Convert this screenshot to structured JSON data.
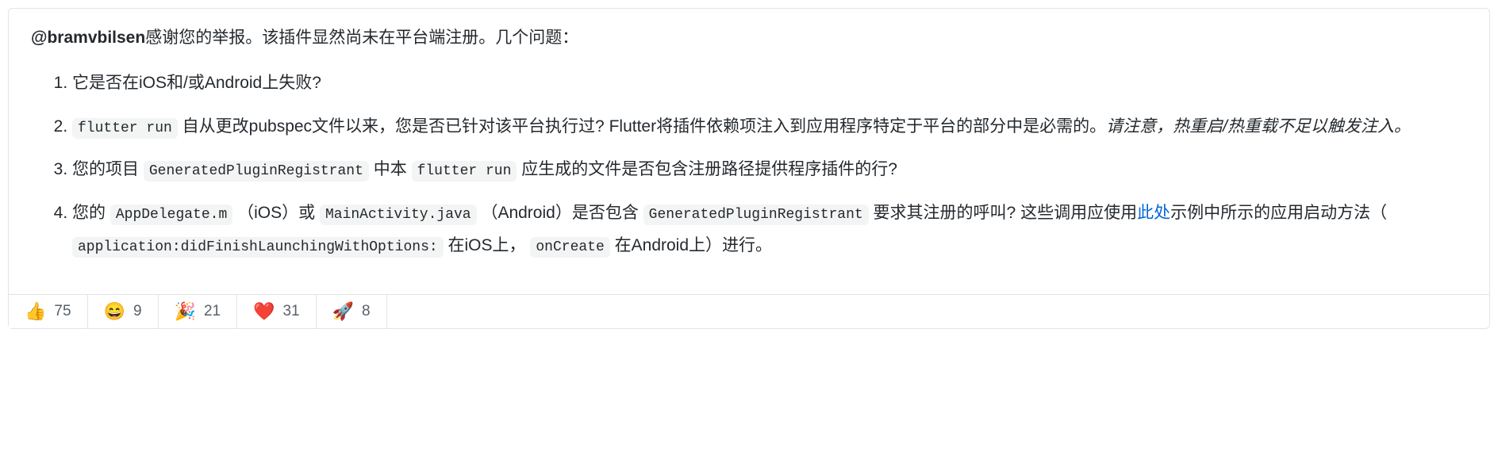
{
  "comment": {
    "mention": "@bramvbilsen",
    "intro_text": "感谢您的举报。该插件显然尚未在平台端注册。几个问题：",
    "questions": {
      "q1": "它是否在iOS和/或Android上失败?",
      "q2": {
        "code_flutter_run": "flutter run",
        "text_after_code": " 自从更改pubspec文件以来，您是否已针对该平台执行过? Flutter将插件依赖项注入到应用程序特定于平台的部分中是必需的。",
        "italic_note": "请注意，热重启/热重载不足以触发注入。"
      },
      "q3": {
        "text_before_code1": "您的项目 ",
        "code_gpr": "GeneratedPluginRegistrant",
        "text_middle": " 中本 ",
        "code_flutter_run": "flutter run",
        "text_after": " 应生成的文件是否包含注册路径提供程序插件的行?"
      },
      "q4": {
        "text_before_code1": "您的 ",
        "code_appdelegate": "AppDelegate.m",
        "text_ios": " （iOS）或 ",
        "code_mainactivity": "MainActivity.java",
        "text_android": " （Android）是否包含 ",
        "code_gpr": "GeneratedPluginRegistrant",
        "text_after_gpr": " 要求其注册的呼叫? 这些调用应使用",
        "link_text": "此处",
        "text_after_link": "示例中所示的应用启动方法（ ",
        "code_didfinish": "application:didFinishLaunchingWithOptions:",
        "text_ios2": " 在iOS上， ",
        "code_oncreate": "onCreate",
        "text_end": " 在Android上）进行。"
      }
    }
  },
  "reactions": [
    {
      "emoji": "👍",
      "count": "75"
    },
    {
      "emoji": "😄",
      "count": "9"
    },
    {
      "emoji": "🎉",
      "count": "21"
    },
    {
      "emoji": "❤️",
      "count": "31"
    },
    {
      "emoji": "🚀",
      "count": "8"
    }
  ]
}
